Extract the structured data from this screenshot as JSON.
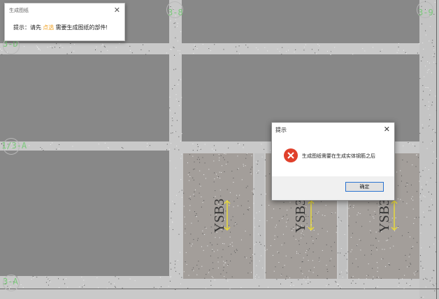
{
  "drawing": {
    "grid_labels": {
      "top_mid": "3-8",
      "top_right": "3-9",
      "left_upper": "3-D",
      "left_mid": "1/3-A",
      "left_bottom": "3-A"
    },
    "slab_labels": [
      "YSB3",
      "YSB3",
      "YSB3"
    ],
    "colors": {
      "slab": "#888888",
      "beam": "#c9c9c9",
      "grid_text": "#7ac97a",
      "rebar": "#e8d83a"
    }
  },
  "hint_panel": {
    "title": "生成图纸",
    "message_prefix": "提示：请先",
    "message_highlight": "点选",
    "message_suffix": "需要生成图纸的部件!",
    "close_icon": "close-icon"
  },
  "dialog": {
    "title": "提示",
    "message": "生成图纸需要在生成实体钢筋之后",
    "ok_label": "确定",
    "icon": "error-icon",
    "close_icon": "close-icon"
  }
}
